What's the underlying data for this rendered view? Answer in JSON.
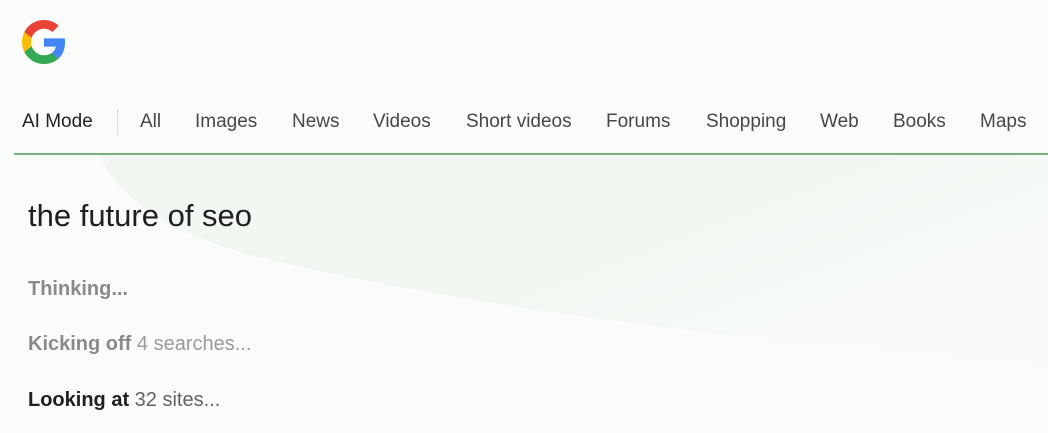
{
  "tabs": [
    {
      "label": "AI Mode",
      "active": true
    },
    {
      "label": "All"
    },
    {
      "label": "Images"
    },
    {
      "label": "News"
    },
    {
      "label": "Videos"
    },
    {
      "label": "Short videos"
    },
    {
      "label": "Forums"
    },
    {
      "label": "Shopping"
    },
    {
      "label": "Web"
    },
    {
      "label": "Books"
    },
    {
      "label": "Maps"
    }
  ],
  "query": "the future of seo",
  "status": {
    "thinking": "Thinking...",
    "kicking_off_strong": "Kicking off",
    "kicking_off_rest": " 4 searches...",
    "looking_at_strong": "Looking at",
    "looking_at_rest": " 32 sites..."
  },
  "colors": {
    "google_blue": "#4285F4",
    "google_red": "#EA4335",
    "google_yellow": "#FBBC05",
    "google_green": "#34A853",
    "tab_underline": "#7bb07f"
  },
  "icons": {
    "logo": "google-g-logo"
  }
}
